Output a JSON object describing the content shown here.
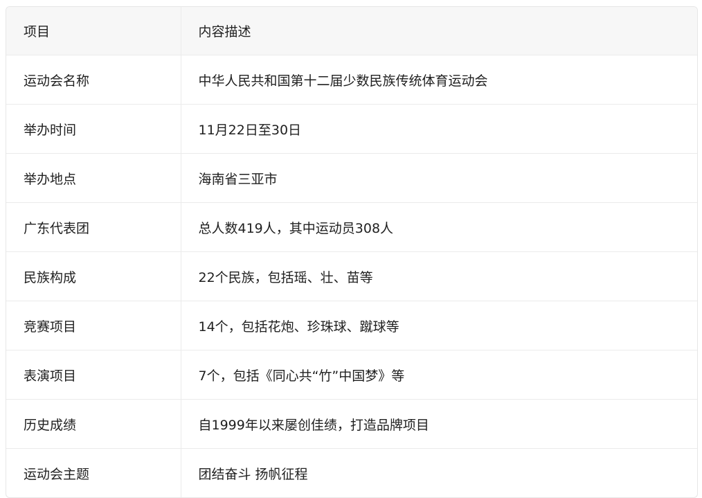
{
  "table": {
    "headers": [
      "项目",
      "内容描述"
    ],
    "rows": [
      [
        "运动会名称",
        "中华人民共和国第十二届少数民族传统体育运动会"
      ],
      [
        "举办时间",
        "11月22日至30日"
      ],
      [
        "举办地点",
        "海南省三亚市"
      ],
      [
        "广东代表团",
        "总人数419人，其中运动员308人"
      ],
      [
        "民族构成",
        "22个民族，包括瑶、壮、苗等"
      ],
      [
        "竞赛项目",
        "14个，包括花炮、珍珠球、蹴球等"
      ],
      [
        "表演项目",
        "7个，包括《同心共“竹”中国梦》等"
      ],
      [
        "历史成绩",
        "自1999年以来屡创佳绩，打造品牌项目"
      ],
      [
        "运动会主题",
        "团结奋斗 扬帆征程"
      ]
    ]
  }
}
